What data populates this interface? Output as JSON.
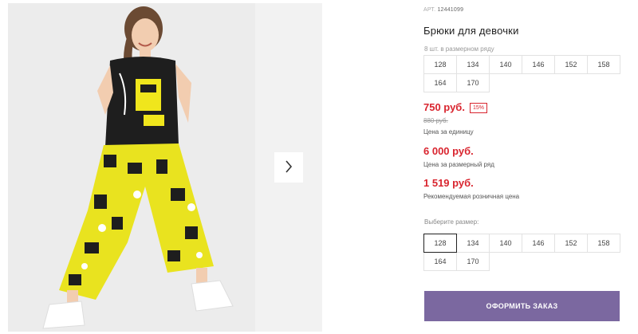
{
  "product": {
    "sku_label": "АРТ.",
    "sku": "12441099",
    "title": "Брюки для девочки"
  },
  "pack": {
    "note": "8 шт. в размерном ряду",
    "sizes_row1": [
      "128",
      "134",
      "140",
      "146",
      "152",
      "158"
    ],
    "sizes_row2": [
      "164",
      "170"
    ]
  },
  "pricing": {
    "price": "750 руб.",
    "discount": "15%",
    "old_price": "880 руб.",
    "unit_label": "Цена за единицу",
    "pack_price": "6 000 руб.",
    "pack_label": "Цена за размерный ряд",
    "retail_price": "1 519 руб.",
    "retail_label": "Рекомендуемая розничная цена"
  },
  "size_select": {
    "label": "Выберите размер:",
    "sizes_row1": [
      "128",
      "134",
      "140",
      "146",
      "152",
      "158"
    ],
    "sizes_row2": [
      "164",
      "170"
    ],
    "selected": "128"
  },
  "gallery": {
    "next_icon": "chevron-right-icon"
  },
  "actions": {
    "order_label": "ОФОРМИТЬ ЗАКАЗ"
  },
  "colors": {
    "accent_button": "#7b68a0",
    "price_red": "#d9252f"
  }
}
